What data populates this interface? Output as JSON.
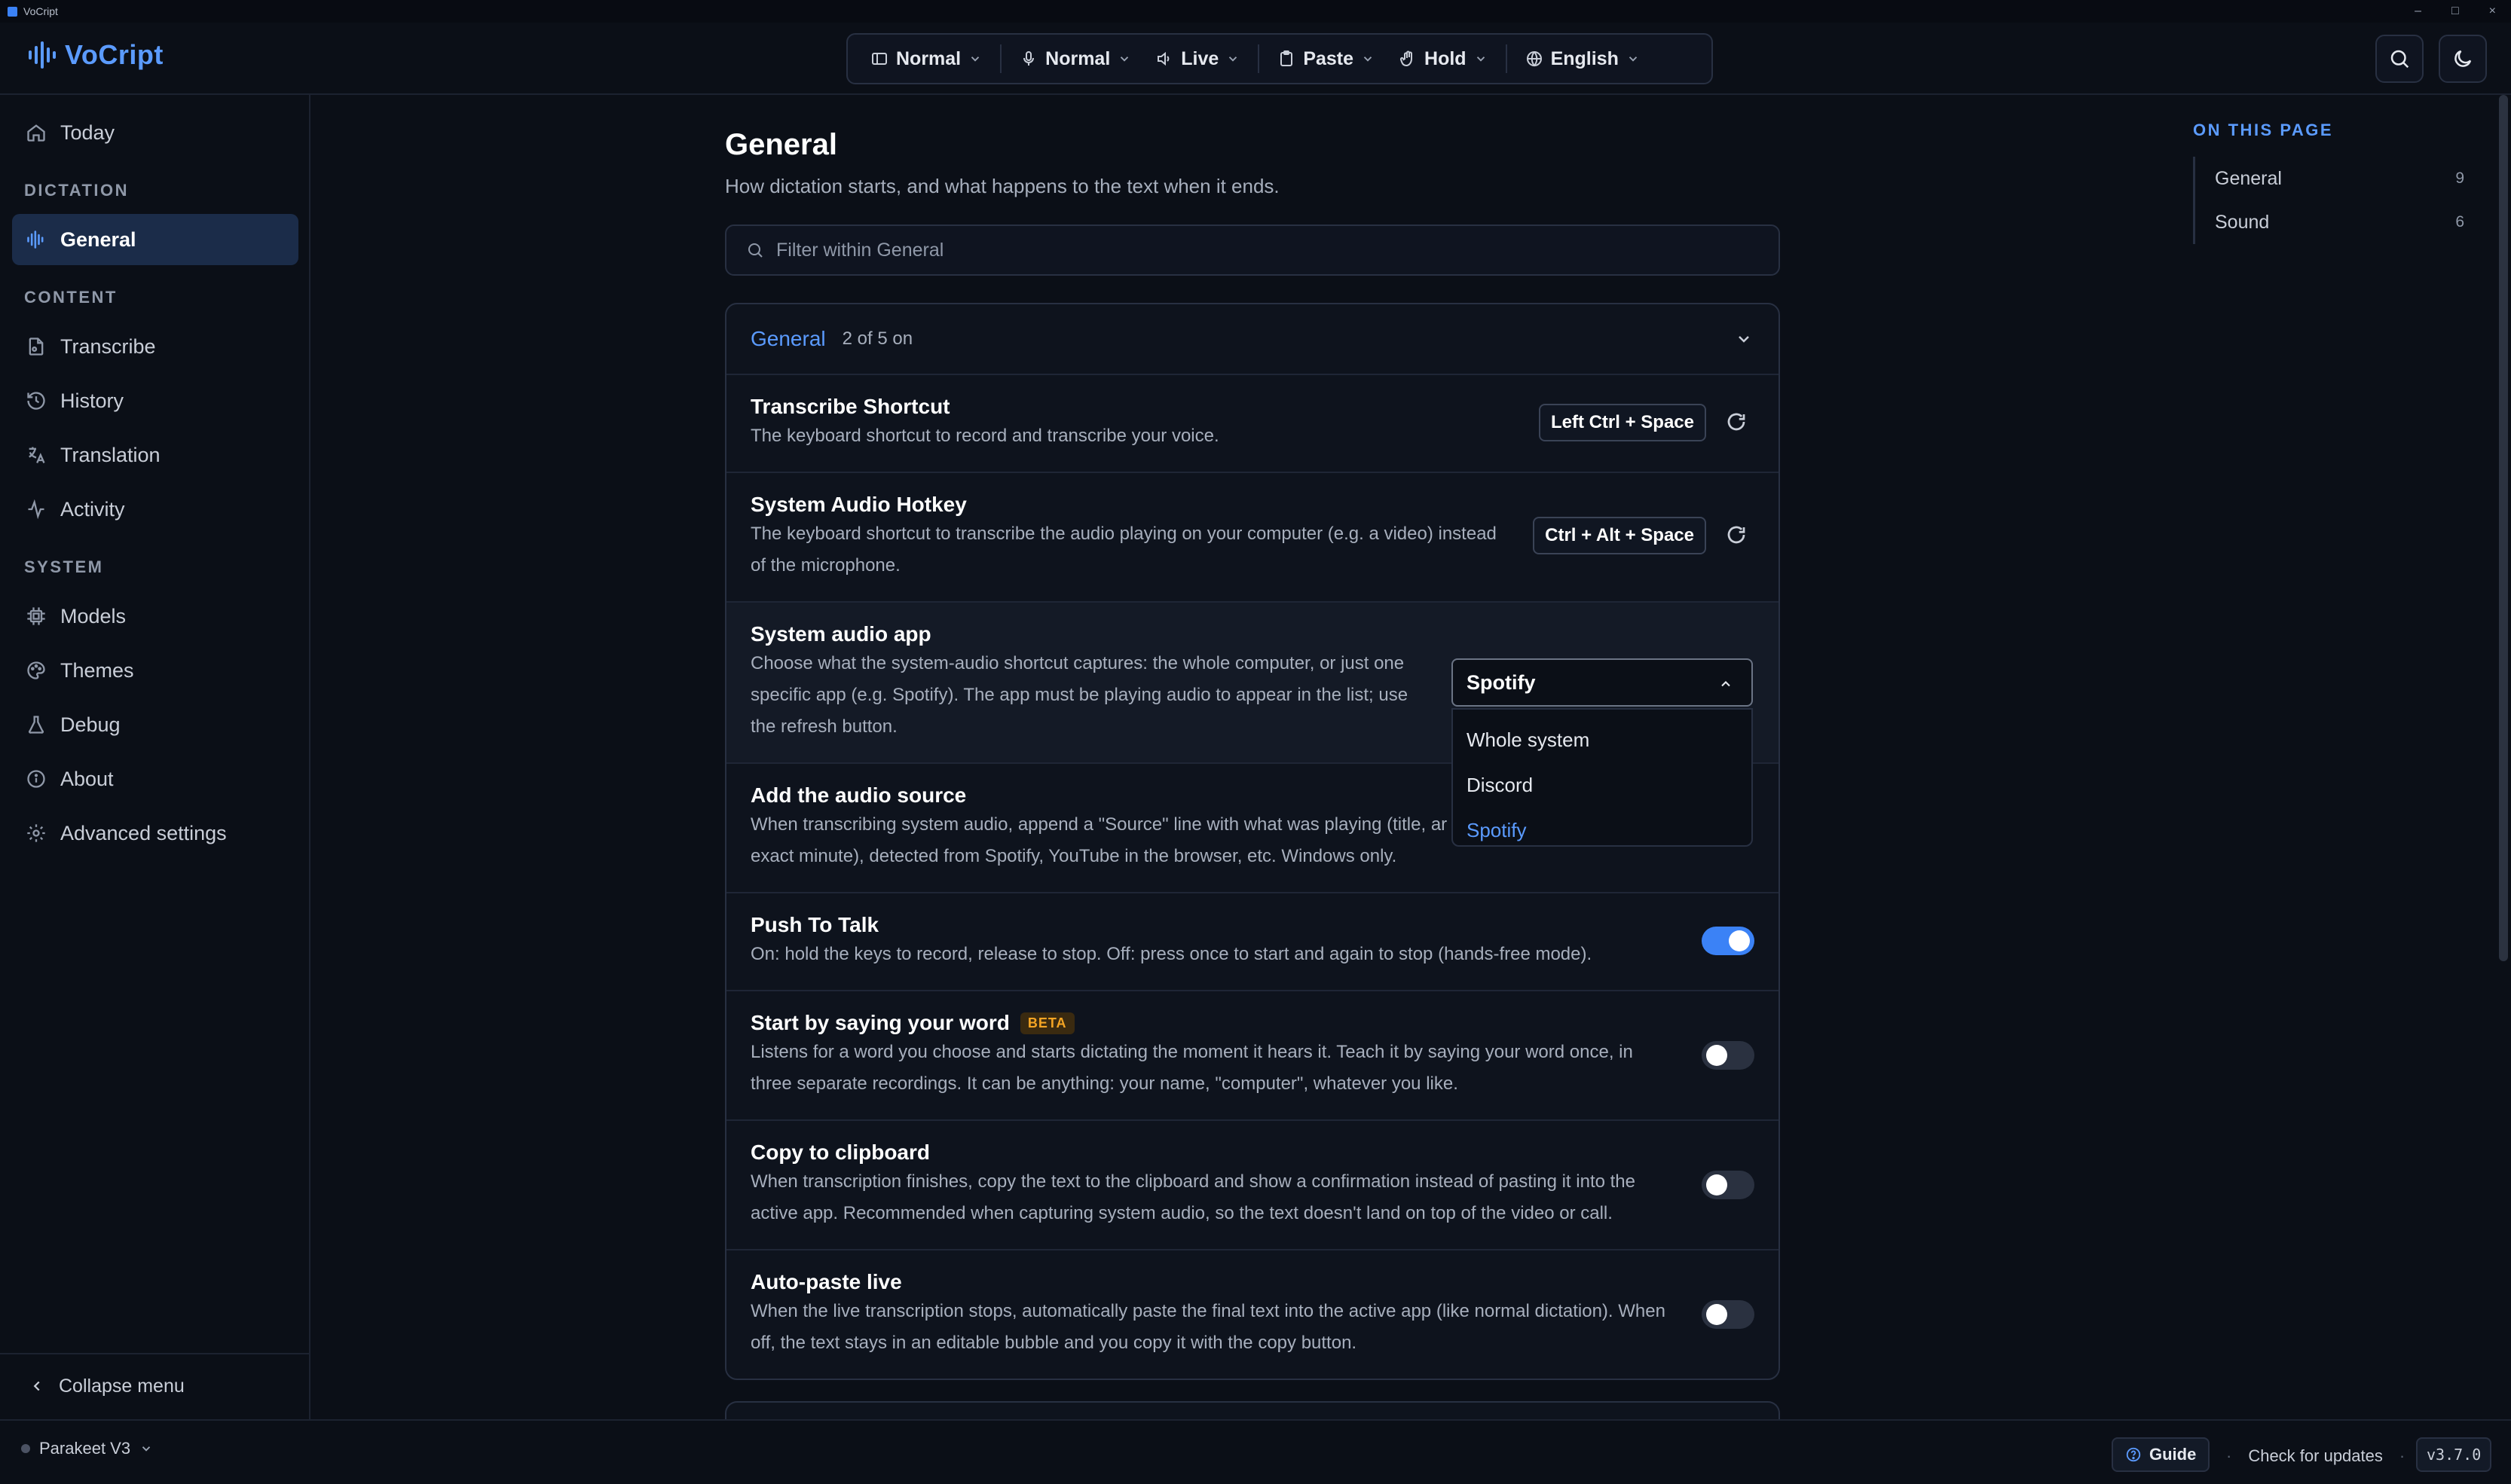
{
  "window": {
    "title": "VoCript",
    "controls": [
      "–",
      "□",
      "×"
    ]
  },
  "app": {
    "name": "VoCript",
    "accent": "#3b82f6"
  },
  "toolbar": {
    "items": [
      {
        "label": "Normal",
        "icon": "layout-icon"
      },
      {
        "label": "Normal",
        "icon": "microphone-icon"
      },
      {
        "label": "Live",
        "icon": "speaker-icon"
      },
      {
        "label": "Paste",
        "icon": "clipboard-icon"
      },
      {
        "label": "Hold",
        "icon": "hand-icon"
      },
      {
        "label": "English",
        "icon": "globe-icon"
      }
    ]
  },
  "sidebar": {
    "today": "Today",
    "sections": {
      "dictation": "DICTATION",
      "content": "CONTENT",
      "system": "SYSTEM"
    },
    "items": {
      "general": "General",
      "transcribe": "Transcribe",
      "history": "History",
      "translation": "Translation",
      "activity": "Activity",
      "models": "Models",
      "themes": "Themes",
      "debug": "Debug",
      "about": "About",
      "advanced": "Advanced settings"
    },
    "collapse": "Collapse menu"
  },
  "page": {
    "title": "General",
    "subtitle": "How dictation starts, and what happens to the text when it ends.",
    "filter_placeholder": "Filter within General"
  },
  "panel": {
    "title": "General",
    "count": "2 of 5 on",
    "rows": [
      {
        "title": "Transcribe Shortcut",
        "desc": "The keyboard shortcut to record and transcribe your voice.",
        "shortcut": "Left Ctrl + Space"
      },
      {
        "title": "System Audio Hotkey",
        "desc": "The keyboard shortcut to transcribe the audio playing on your computer (e.g. a video) instead of the microphone.",
        "shortcut": "Ctrl + Alt + Space"
      },
      {
        "title": "System audio app",
        "desc": "Choose what the system-audio shortcut captures: the whole computer, or just one specific app (e.g. Spotify). The app must be playing audio to appear in the list; use the refresh button.",
        "selected": "Spotify",
        "options": [
          "Whole system",
          "Discord",
          "Spotify"
        ]
      },
      {
        "title": "Add the audio source",
        "desc": "When transcribing system audio, append a \"Source\" line with what was playing (title, ar",
        "desc2": "exact minute), detected from Spotify, YouTube in the browser, etc. Windows only."
      },
      {
        "title": "Push To Talk",
        "desc": "On: hold the keys to record, release to stop. Off: press once to start and again to stop (hands-free mode).",
        "on": true
      },
      {
        "title": "Start by saying your word",
        "badge": "BETA",
        "desc": "Listens for a word you choose and starts dictating the moment it hears it. Teach it by saying your word once, in three separate recordings. It can be anything: your name, \"computer\", whatever you like.",
        "on": false
      },
      {
        "title": "Copy to clipboard",
        "desc": "When transcription finishes, copy the text to the clipboard and show a confirmation instead of pasting it into the active app. Recommended when capturing system audio, so the text doesn't land on top of the video or call.",
        "on": false
      },
      {
        "title": "Auto-paste live",
        "desc": "When the live transcription stops, automatically paste the final text into the active app (like normal dictation). When off, the text stays in an editable bubble and you copy it with the copy button.",
        "on": false
      }
    ]
  },
  "toc": {
    "heading": "ON THIS PAGE",
    "items": [
      {
        "label": "General",
        "count": "9"
      },
      {
        "label": "Sound",
        "count": "6"
      }
    ]
  },
  "status": {
    "model": "Parakeet V3",
    "guide": "Guide",
    "updates": "Check for updates",
    "version": "v3.7.0"
  }
}
